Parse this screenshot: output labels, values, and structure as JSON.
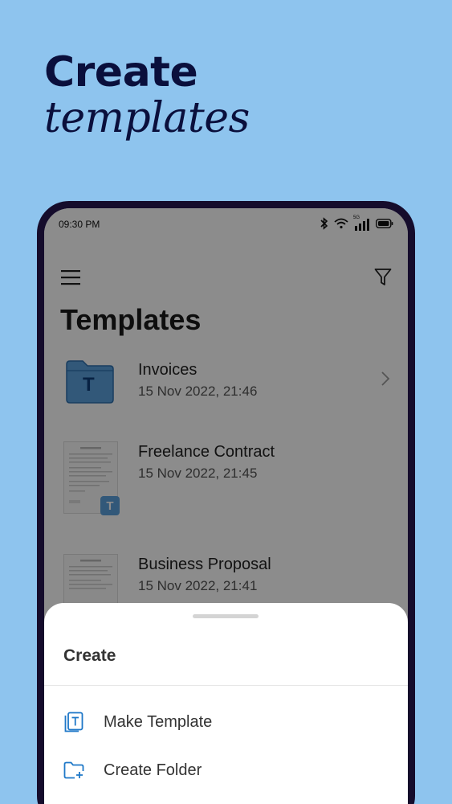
{
  "promo": {
    "line1": "Create",
    "line2": "templates"
  },
  "status_bar": {
    "time": "09:30 PM",
    "network": "5G"
  },
  "page": {
    "title": "Templates"
  },
  "templates": [
    {
      "name": "Invoices",
      "date": "15 Nov 2022, 21:46",
      "type": "folder",
      "badge": "T"
    },
    {
      "name": "Freelance Contract",
      "date": "15 Nov 2022, 21:45",
      "type": "document",
      "badge": "T"
    },
    {
      "name": "Business Proposal",
      "date": "15 Nov 2022, 21:41",
      "type": "document"
    }
  ],
  "sheet": {
    "title": "Create",
    "actions": [
      {
        "label": "Make Template",
        "icon": "template-icon"
      },
      {
        "label": "Create Folder",
        "icon": "folder-add-icon"
      }
    ]
  },
  "colors": {
    "background": "#8ec4ee",
    "promo_text": "#0a0f3c",
    "accent": "#1f78c8",
    "folder": "#5ba0dc"
  }
}
